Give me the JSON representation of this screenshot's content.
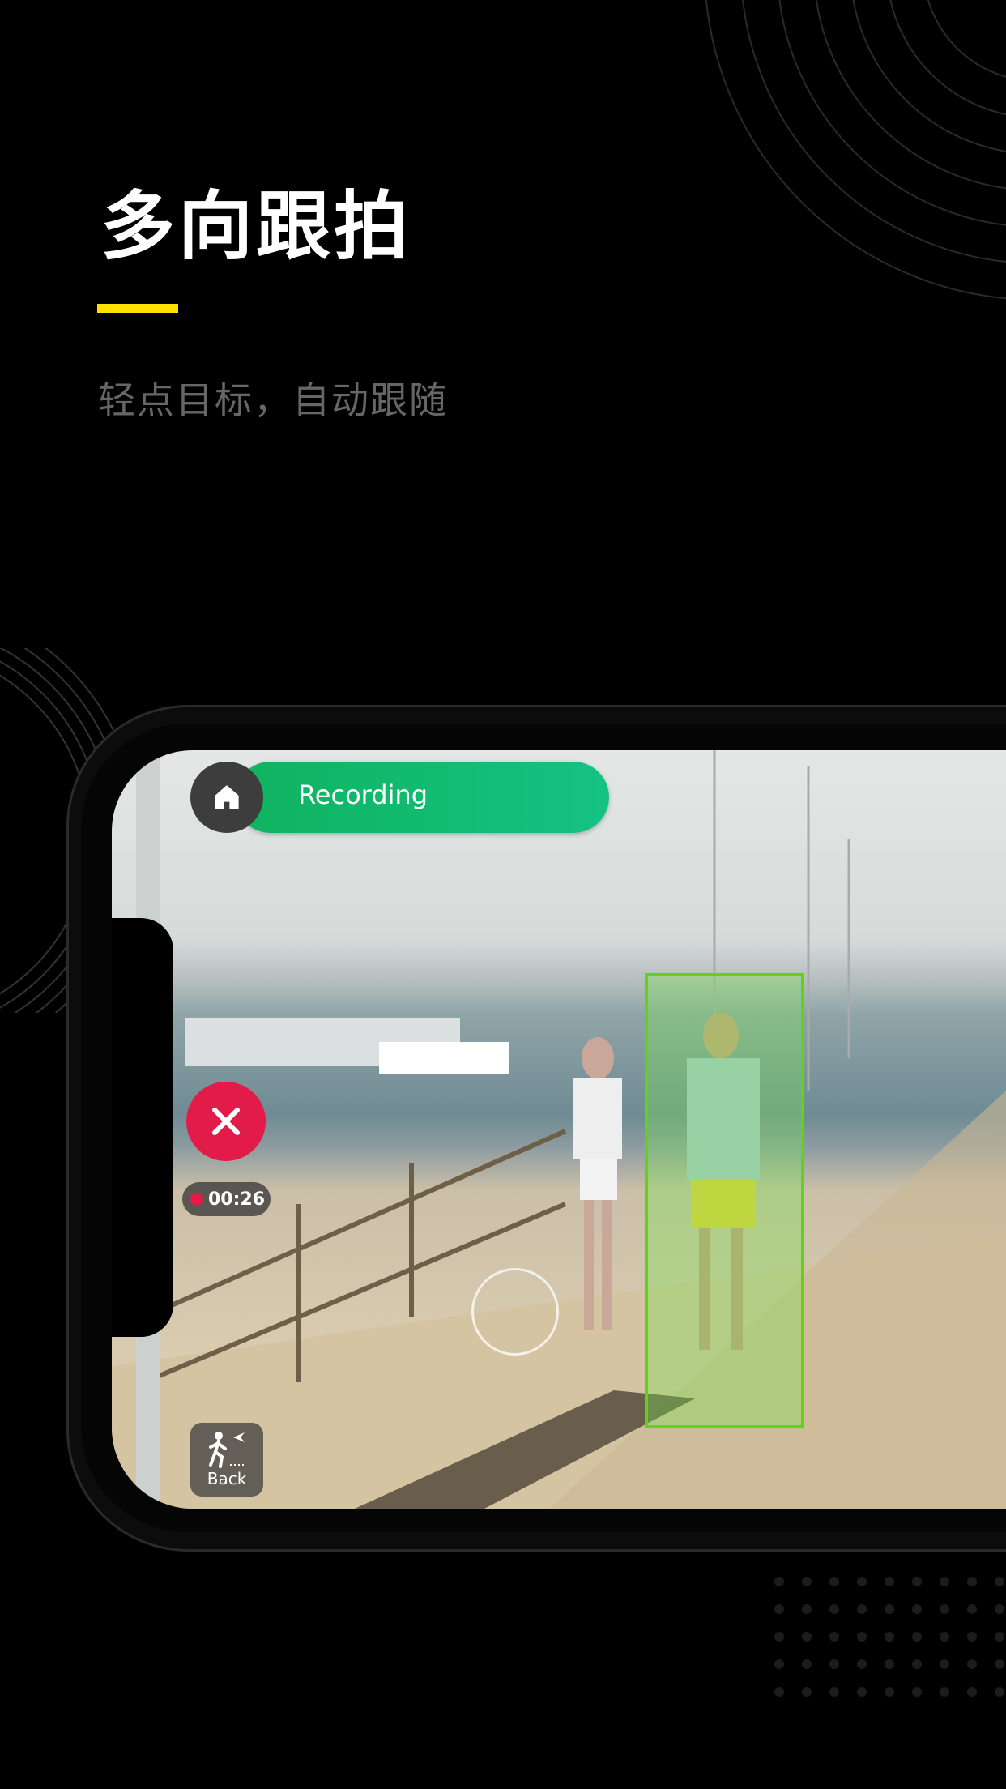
{
  "header": {
    "title": "多向跟拍",
    "subtitle": "轻点目标，自动跟随",
    "accent_color": "#ffe000"
  },
  "camera_ui": {
    "home_icon": "home-icon",
    "status_label": "Recording",
    "status_color": "#13bb6e",
    "close_icon": "close-icon",
    "close_color": "#e21b48",
    "timer": "00:26",
    "back_label": "Back",
    "back_icon": "walking-person-icon",
    "tracking_box_color": "#5fd31c"
  }
}
